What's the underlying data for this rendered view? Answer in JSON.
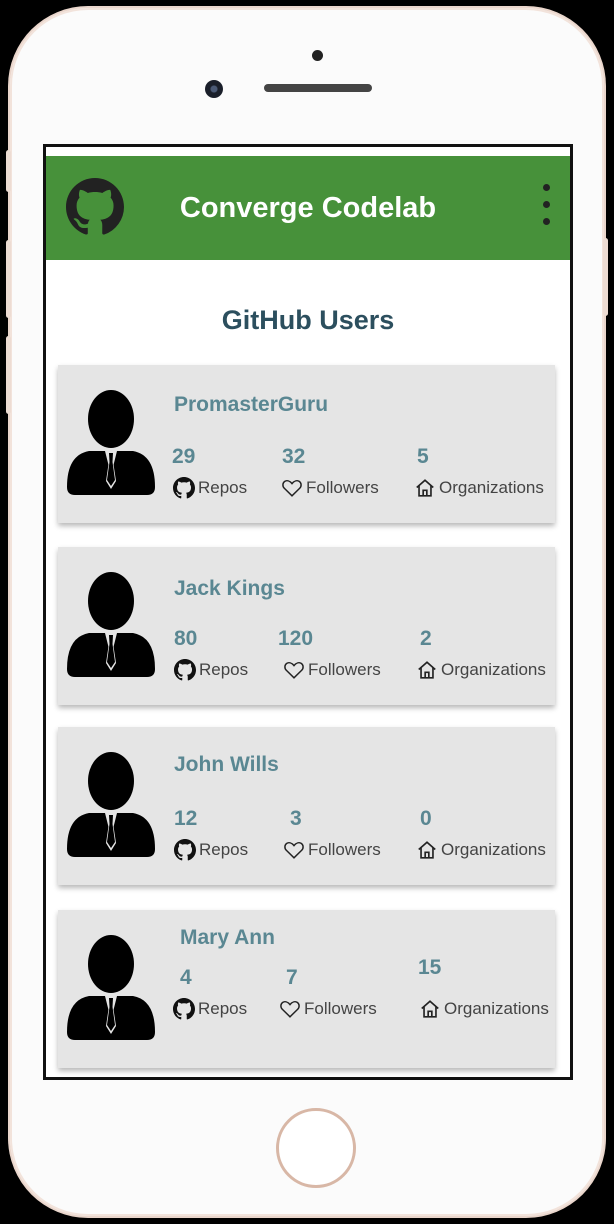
{
  "app": {
    "title": "Converge Codelab"
  },
  "page": {
    "heading": "GitHub Users"
  },
  "users": [
    {
      "name": "PromasterGuru",
      "repos": "29",
      "followers": "32",
      "organizations": "5"
    },
    {
      "name": "Jack Kings",
      "repos": "80",
      "followers": "120",
      "organizations": "2"
    },
    {
      "name": "John Wills",
      "repos": "12",
      "followers": "3",
      "organizations": "0"
    },
    {
      "name": "Mary Ann",
      "repos": "4",
      "followers": "7",
      "organizations": "15"
    }
  ],
  "labels": {
    "repos": "Repos",
    "followers": "Followers",
    "organizations": "Organizations"
  },
  "icons": {
    "app_logo": "github-icon",
    "menu": "more-vert-icon",
    "avatar": "person-icon",
    "repos": "github-icon",
    "followers": "heart-icon",
    "organizations": "home-icon"
  },
  "colors": {
    "appbar": "#47913a",
    "heading": "#2c4f5e",
    "accent_text": "#5a8792",
    "card": "#e5e5e5"
  }
}
